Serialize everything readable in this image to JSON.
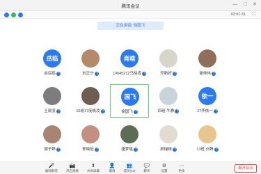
{
  "window": {
    "title": "腾讯会议",
    "minimize": "—",
    "maximize": "□",
    "close": "✕"
  },
  "infobar": {
    "timer": "02:01:31",
    "fullscreen_icon": "⛶",
    "colors": {
      "info": "#2c7af1",
      "security": "#37b35e",
      "network": "#2c7af1"
    }
  },
  "speaking": {
    "text": "正在讲话: 徐国飞"
  },
  "participants": [
    {
      "name": "谷召临",
      "avatar_text": "岳临",
      "type": "text",
      "photo_color": ""
    },
    {
      "name": "刘正宁",
      "avatar_text": "",
      "type": "photo",
      "photo_color": "#b58a6a"
    },
    {
      "name": "19045212马晓肯",
      "avatar_text": "肖晗",
      "type": "text",
      "photo_color": ""
    },
    {
      "name": "乔新好",
      "avatar_text": "",
      "type": "photo",
      "photo_color": "#d9d5c8"
    },
    {
      "name": "谢帅伟",
      "avatar_text": "",
      "type": "photo",
      "photo_color": "#8f6e5a"
    },
    {
      "name": "王锐凌",
      "avatar_text": "",
      "type": "photo",
      "photo_color": "#7d7d7d"
    },
    {
      "name": "10班17庞帆凌",
      "avatar_text": "",
      "type": "photo",
      "photo_color": "#6e5d53"
    },
    {
      "name": "徐国飞",
      "avatar_text": "国飞",
      "type": "text",
      "photo_color": ""
    },
    {
      "name": "四班 牛静",
      "avatar_text": "",
      "type": "photo",
      "photo_color": "#c9d3dc"
    },
    {
      "name": "27李依一",
      "avatar_text": "依一",
      "type": "text",
      "photo_color": ""
    },
    {
      "name": "闻子婷",
      "avatar_text": "",
      "type": "photo",
      "photo_color": "#a88472"
    },
    {
      "name": "邢晓怡",
      "avatar_text": "",
      "type": "photo",
      "photo_color": "#c48f7e"
    },
    {
      "name": "唐梦瑶",
      "avatar_text": "",
      "type": "photo",
      "photo_color": "#5e6b55"
    },
    {
      "name": "颜瑞晴",
      "avatar_text": "",
      "type": "photo",
      "photo_color": "#e2dcd0"
    },
    {
      "name": "13班 刘昂",
      "avatar_text": "",
      "type": "photo",
      "photo_color": "#e8c58f"
    }
  ],
  "toolbar": {
    "items": [
      {
        "label": "解除静音",
        "icon": "🎤"
      },
      {
        "label": "开启视频",
        "icon": "📷"
      },
      {
        "label": "共享屏幕",
        "icon": "⬆"
      },
      {
        "label": "邀请",
        "icon": "👤"
      },
      {
        "label": "成员(15)",
        "icon": "👥"
      },
      {
        "label": "聊天",
        "icon": "💬"
      },
      {
        "label": "设置",
        "icon": "⚙"
      },
      {
        "label": "更多",
        "icon": "⋯"
      }
    ],
    "end_label": "离开会议",
    "end_color": "#e04545"
  }
}
